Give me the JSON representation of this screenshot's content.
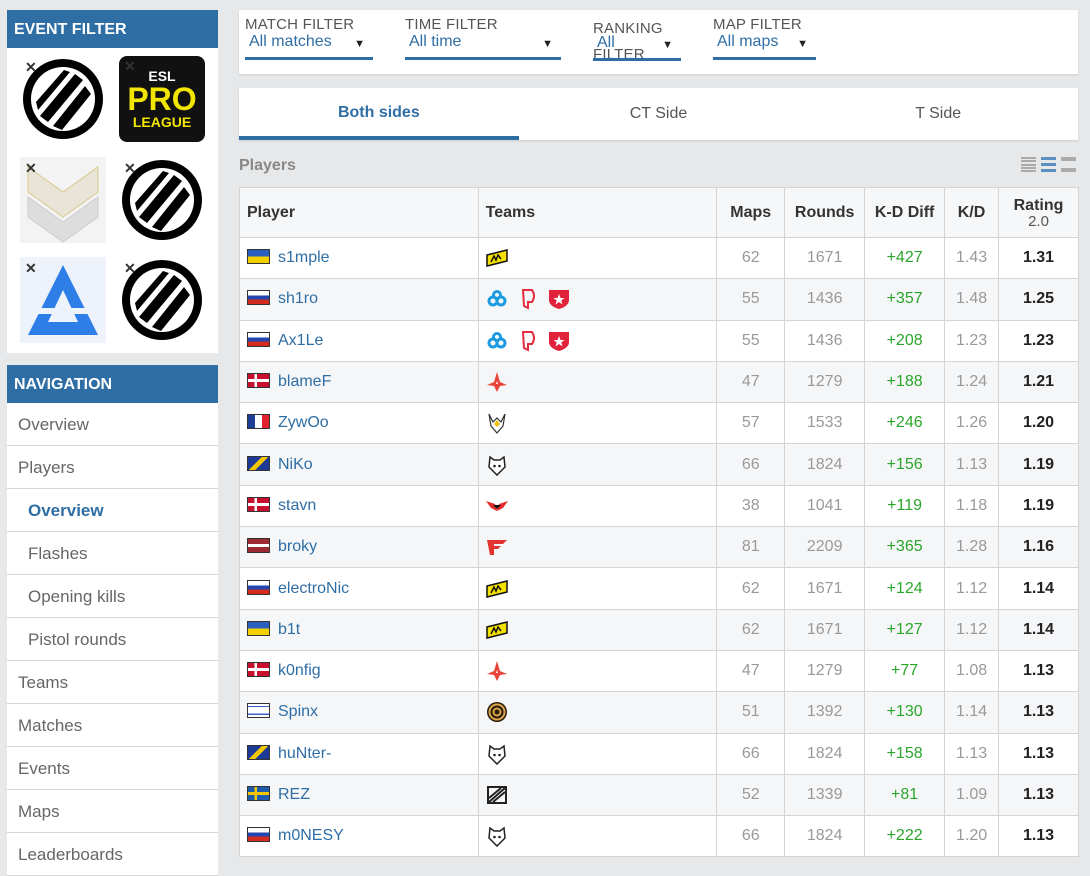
{
  "sidebar": {
    "event_filter_title": "EVENT FILTER",
    "event_logos": [
      "blast-logo",
      "esl-pro-league-logo",
      "iem-chevron-logo",
      "blast-logo",
      "blast-premier-logo",
      "blast-logo"
    ],
    "esl_logo_text": [
      "ESL",
      "PRO",
      "LEAGUE"
    ],
    "navigation_title": "NAVIGATION",
    "nav": [
      {
        "label": "Overview",
        "sub": false,
        "active": false
      },
      {
        "label": "Players",
        "sub": false,
        "active": false
      },
      {
        "label": "Overview",
        "sub": true,
        "active": true
      },
      {
        "label": "Flashes",
        "sub": true,
        "active": false
      },
      {
        "label": "Opening kills",
        "sub": true,
        "active": false
      },
      {
        "label": "Pistol rounds",
        "sub": true,
        "active": false
      },
      {
        "label": "Teams",
        "sub": false,
        "active": false
      },
      {
        "label": "Matches",
        "sub": false,
        "active": false
      },
      {
        "label": "Events",
        "sub": false,
        "active": false
      },
      {
        "label": "Maps",
        "sub": false,
        "active": false
      },
      {
        "label": "Leaderboards",
        "sub": false,
        "active": false
      }
    ]
  },
  "filters": [
    {
      "label": "MATCH FILTER",
      "value": "All matches"
    },
    {
      "label": "TIME FILTER",
      "value": "All time"
    },
    {
      "label": "RANKING FILTER",
      "value": "All"
    },
    {
      "label": "MAP FILTER",
      "value": "All maps"
    }
  ],
  "tabs": [
    {
      "label": "Both sides",
      "active": true
    },
    {
      "label": "CT Side",
      "active": false
    },
    {
      "label": "T Side",
      "active": false
    }
  ],
  "players_label": "Players",
  "table": {
    "headers": {
      "player": "Player",
      "teams": "Teams",
      "maps": "Maps",
      "rounds": "Rounds",
      "kddiff": "K-D Diff",
      "kd": "K/D",
      "rating": "Rating",
      "rating_sub": "2.0"
    },
    "rows": [
      {
        "name": "s1mple",
        "flag": "ua",
        "teams": [
          "navi"
        ],
        "maps": "62",
        "rounds": "1671",
        "kddiff": "+427",
        "kd": "1.43",
        "rating": "1.31"
      },
      {
        "name": "sh1ro",
        "flag": "ru",
        "teams": [
          "cloud9",
          "dignitas",
          "gambit"
        ],
        "maps": "55",
        "rounds": "1436",
        "kddiff": "+357",
        "kd": "1.48",
        "rating": "1.25"
      },
      {
        "name": "Ax1Le",
        "flag": "ru",
        "teams": [
          "cloud9",
          "dignitas",
          "gambit"
        ],
        "maps": "55",
        "rounds": "1436",
        "kddiff": "+208",
        "kd": "1.23",
        "rating": "1.23"
      },
      {
        "name": "blameF",
        "flag": "dk",
        "teams": [
          "astralis"
        ],
        "maps": "47",
        "rounds": "1279",
        "kddiff": "+188",
        "kd": "1.24",
        "rating": "1.21"
      },
      {
        "name": "ZywOo",
        "flag": "fr",
        "teams": [
          "vitality"
        ],
        "maps": "57",
        "rounds": "1533",
        "kddiff": "+246",
        "kd": "1.26",
        "rating": "1.20"
      },
      {
        "name": "NiKo",
        "flag": "ba",
        "teams": [
          "g2"
        ],
        "maps": "66",
        "rounds": "1824",
        "kddiff": "+156",
        "kd": "1.13",
        "rating": "1.19"
      },
      {
        "name": "stavn",
        "flag": "dk",
        "teams": [
          "heroic"
        ],
        "maps": "38",
        "rounds": "1041",
        "kddiff": "+119",
        "kd": "1.18",
        "rating": "1.19"
      },
      {
        "name": "broky",
        "flag": "lv",
        "teams": [
          "faze"
        ],
        "maps": "81",
        "rounds": "2209",
        "kddiff": "+365",
        "kd": "1.28",
        "rating": "1.16"
      },
      {
        "name": "electroNic",
        "flag": "ru",
        "teams": [
          "navi"
        ],
        "maps": "62",
        "rounds": "1671",
        "kddiff": "+124",
        "kd": "1.12",
        "rating": "1.14"
      },
      {
        "name": "b1t",
        "flag": "ua",
        "teams": [
          "navi"
        ],
        "maps": "62",
        "rounds": "1671",
        "kddiff": "+127",
        "kd": "1.12",
        "rating": "1.14"
      },
      {
        "name": "k0nfig",
        "flag": "dk",
        "teams": [
          "astralis"
        ],
        "maps": "47",
        "rounds": "1279",
        "kddiff": "+77",
        "kd": "1.08",
        "rating": "1.13"
      },
      {
        "name": "Spinx",
        "flag": "il",
        "teams": [
          "ence"
        ],
        "maps": "51",
        "rounds": "1392",
        "kddiff": "+130",
        "kd": "1.14",
        "rating": "1.13"
      },
      {
        "name": "huNter-",
        "flag": "ba",
        "teams": [
          "g2"
        ],
        "maps": "66",
        "rounds": "1824",
        "kddiff": "+158",
        "kd": "1.13",
        "rating": "1.13"
      },
      {
        "name": "REZ",
        "flag": "se",
        "teams": [
          "nip"
        ],
        "maps": "52",
        "rounds": "1339",
        "kddiff": "+81",
        "kd": "1.09",
        "rating": "1.13"
      },
      {
        "name": "m0NESY",
        "flag": "ru",
        "teams": [
          "g2"
        ],
        "maps": "66",
        "rounds": "1824",
        "kddiff": "+222",
        "kd": "1.20",
        "rating": "1.13"
      }
    ]
  },
  "colors": {
    "accent": "#2f6ea5",
    "positive": "#2aa52a"
  }
}
